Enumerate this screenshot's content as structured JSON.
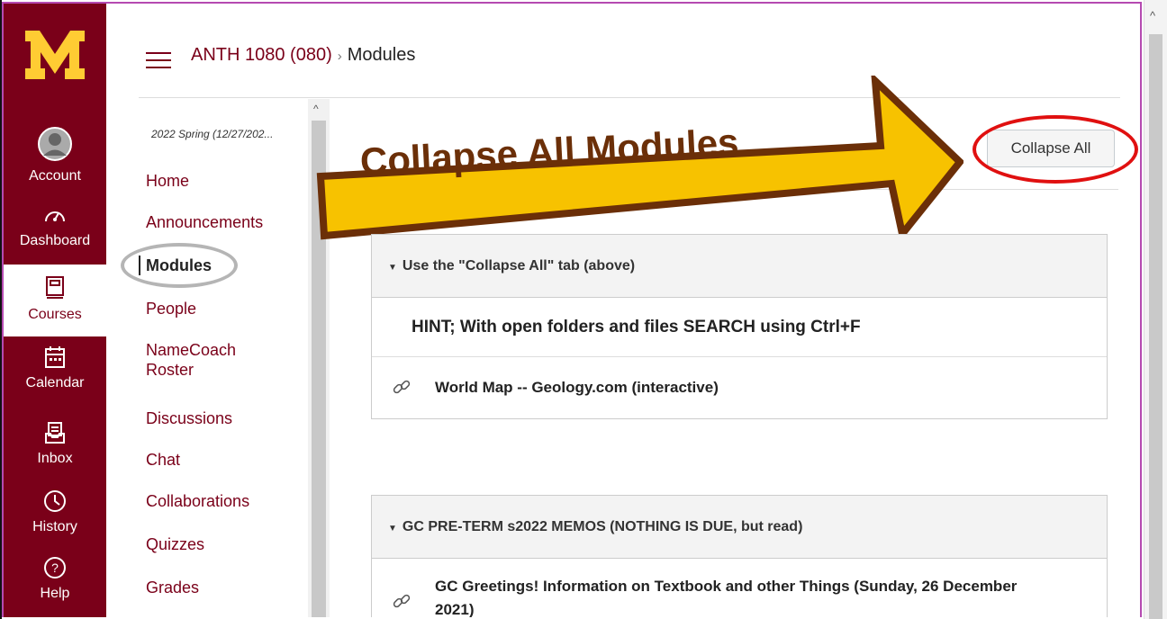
{
  "global_nav": {
    "items": [
      {
        "label": "Account",
        "icon": "avatar"
      },
      {
        "label": "Dashboard",
        "icon": "dashboard-icon"
      },
      {
        "label": "Courses",
        "icon": "courses-icon",
        "active": true
      },
      {
        "label": "Calendar",
        "icon": "calendar-icon"
      },
      {
        "label": "Inbox",
        "icon": "inbox-icon"
      },
      {
        "label": "History",
        "icon": "history-icon"
      },
      {
        "label": "Help",
        "icon": "help-icon"
      }
    ],
    "brand_color": "#7a0019",
    "logo_color": "#ffcc33"
  },
  "breadcrumb": {
    "course": "ANTH 1080 (080)",
    "separator": "›",
    "current": "Modules"
  },
  "course_nav": {
    "term": "2022 Spring (12/27/202...",
    "items": [
      {
        "label": "Home"
      },
      {
        "label": "Announcements"
      },
      {
        "label": "Modules",
        "active": true
      },
      {
        "label": "People"
      },
      {
        "label": "NameCoach",
        "label2": "Roster"
      },
      {
        "label": "Discussions"
      },
      {
        "label": "Chat"
      },
      {
        "label": "Collaborations"
      },
      {
        "label": "Quizzes"
      },
      {
        "label": "Grades"
      }
    ]
  },
  "toolbar": {
    "collapse_all_label": "Collapse All"
  },
  "annotation": {
    "arrow_text": "Collapse All Modules",
    "arrow_fill": "#f7c200",
    "arrow_stroke": "#6b2f08",
    "circle_color": "#e01010"
  },
  "modules": [
    {
      "title": "Use the \"Collapse All\" tab (above)",
      "items": [
        {
          "type": "text",
          "text": "HINT; With open folders and files SEARCH using Ctrl+F"
        },
        {
          "type": "link",
          "text": "World Map -- Geology.com (interactive)",
          "icon": "link-icon"
        }
      ]
    },
    {
      "title": "GC PRE-TERM s2022 MEMOS (NOTHING IS DUE, but read)",
      "items": [
        {
          "type": "link",
          "text": "GC Greetings! Information on Textbook and other Things (Sunday, 26 December 2021)",
          "icon": "link-icon"
        }
      ]
    }
  ]
}
